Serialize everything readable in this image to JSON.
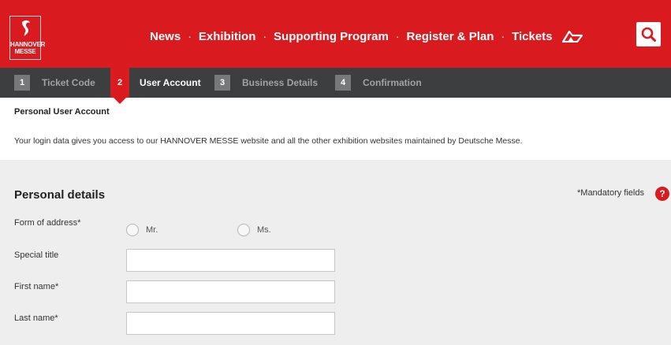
{
  "header": {
    "logo_line1": "HANNOVER",
    "logo_line2": "MESSE",
    "nav": [
      "News",
      "Exhibition",
      "Supporting Program",
      "Register & Plan",
      "Tickets"
    ],
    "nav_separator": "·",
    "accent_color": "#d91a1f",
    "icons": [
      "messe-logo-icon",
      "mountain-icon",
      "search-icon"
    ]
  },
  "steps": [
    {
      "number": "1",
      "label": "Ticket Code",
      "active": false
    },
    {
      "number": "2",
      "label": "User Account",
      "active": true
    },
    {
      "number": "3",
      "label": "Business Details",
      "active": false
    },
    {
      "number": "4",
      "label": "Confirmation",
      "active": false
    }
  ],
  "intro": {
    "title": "Personal User Account",
    "text": "Your login data gives you access to our HANNOVER MESSE website and all the other exhibition websites maintained by Deutsche Messe."
  },
  "form": {
    "title": "Personal details",
    "mandatory_note": "*Mandatory fields",
    "help_symbol": "?",
    "form_of_address_label": "Form of address*",
    "address_options": [
      "Mr.",
      "Ms."
    ],
    "special_title_label": "Special title",
    "special_title_value": "",
    "first_name_label": "First name*",
    "first_name_value": "",
    "last_name_label": "Last name*",
    "last_name_value": ""
  }
}
